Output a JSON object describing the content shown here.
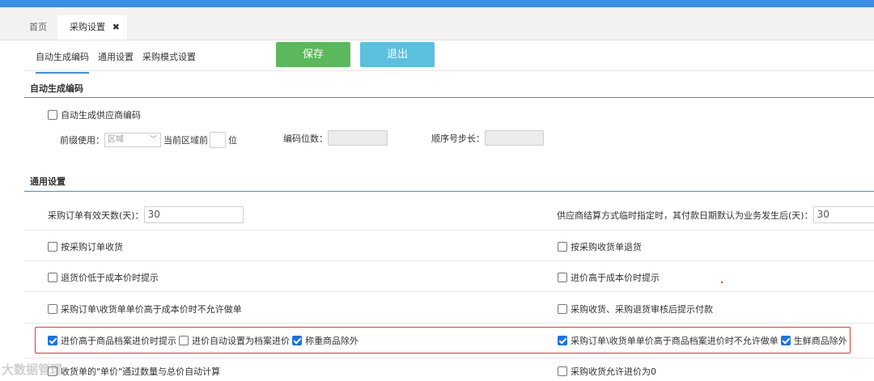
{
  "tabs": {
    "home": "首页",
    "active": "采购设置",
    "close_glyph": "✖"
  },
  "subtabs": [
    "自动生成编码",
    "通用设置",
    "采购模式设置"
  ],
  "buttons": {
    "save": "保存",
    "exit": "退出"
  },
  "auto_code": {
    "title": "自动生成编码",
    "supplier_code_label": "自动生成供应商编码",
    "supplier_code_checked": false,
    "prefix_label": "前缀使用：",
    "prefix_select": "区域",
    "prefix_mid": "当前区域前",
    "prefix_unit": "位",
    "digits_label": "编码位数：",
    "step_label": "顺序号步长："
  },
  "general": {
    "title": "通用设置",
    "valid_days_label": "采购订单有效天数(天)：",
    "valid_days_value": "30",
    "pay_days_label": "供应商结算方式临时指定时，其付款日期默认为业务发生后(天)：",
    "pay_days_value": "30",
    "rows": [
      {
        "left": [
          {
            "label": "按采购订单收货",
            "checked": false
          }
        ],
        "right": [
          {
            "label": "按采购收货单退货",
            "checked": false
          }
        ]
      },
      {
        "left": [
          {
            "label": "退货价低于成本价时提示",
            "checked": false
          }
        ],
        "right": [
          {
            "label": "进价高于成本价时提示",
            "checked": false
          }
        ]
      },
      {
        "left": [
          {
            "label": "采购订单\\收货单单价高于成本价时不允许做单",
            "checked": false
          }
        ],
        "right": [
          {
            "label": "采购收货、采购退货审核后提示付款",
            "checked": false
          }
        ]
      },
      {
        "left": [
          {
            "label": "进价高于商品档案进价时提示",
            "checked": true
          },
          {
            "label": "进价自动设置为档案进价",
            "checked": false
          },
          {
            "label": "称重商品除外",
            "checked": true
          }
        ],
        "right": [
          {
            "label": "采购订单\\收货单单价高于商品档案进价时不允许做单",
            "checked": true
          },
          {
            "label": "生鲜商品除外",
            "checked": true
          }
        ]
      },
      {
        "left": [
          {
            "label": "收货单的\"单价\"通过数量与总价自动计算",
            "checked": false
          }
        ],
        "right": [
          {
            "label": "采购收货允许进价为0",
            "checked": false
          }
        ]
      }
    ]
  },
  "watermark": "大数据管理"
}
